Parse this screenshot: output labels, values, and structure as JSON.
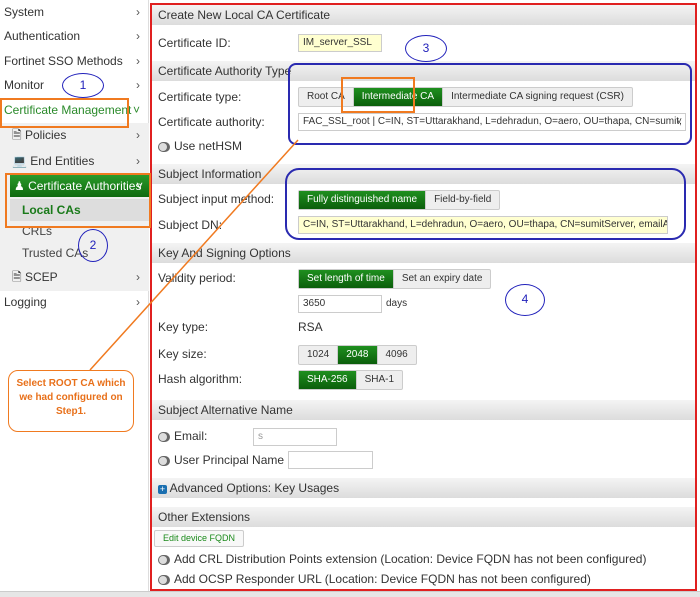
{
  "sidebar": {
    "items": [
      {
        "label": "System"
      },
      {
        "label": "Authentication"
      },
      {
        "label": "Fortinet SSO Methods"
      },
      {
        "label": "Monitor"
      },
      {
        "label": "Certificate Management"
      },
      {
        "label": "Policies"
      },
      {
        "label": "End Entities"
      },
      {
        "label": "Certificate Authorities"
      },
      {
        "label": "Local CAs"
      },
      {
        "label": "CRLs"
      },
      {
        "label": "Trusted CAs"
      },
      {
        "label": "SCEP"
      },
      {
        "label": "Logging"
      }
    ]
  },
  "form": {
    "title": "Create New Local CA Certificate",
    "cert_id_label": "Certificate ID:",
    "cert_id_value": "IM_server_SSL",
    "ca_type_header": "Certificate Authority Type",
    "cert_type_label": "Certificate type:",
    "cert_types": [
      "Root CA",
      "Intermediate CA",
      "Intermediate CA signing request (CSR)"
    ],
    "cert_authority_label": "Certificate authority:",
    "cert_authority_value": "FAC_SSL_root | C=IN, ST=Uttarakhand, L=dehradun, O=aero, OU=thapa, CN=sumit, emailAddress=sthapa@gmail.com",
    "nethsm_label": "Use netHSM",
    "subject_header": "Subject Information",
    "input_method_label": "Subject input method:",
    "input_methods": [
      "Fully distinguished name",
      "Field-by-field"
    ],
    "subject_dn_label": "Subject DN:",
    "subject_dn_value": "C=IN, ST=Uttarakhand, L=dehradun, O=aero, OU=thapa, CN=sumitServer, emailAddress=sthapa@gmail.com",
    "key_header": "Key And Signing Options",
    "validity_label": "Validity period:",
    "validity_options": [
      "Set length of time",
      "Set an expiry date"
    ],
    "validity_value": "3650",
    "validity_unit": "days",
    "key_type_label": "Key type:",
    "key_type_value": "RSA",
    "key_size_label": "Key size:",
    "key_sizes": [
      "1024",
      "2048",
      "4096"
    ],
    "hash_label": "Hash algorithm:",
    "hashes": [
      "SHA-256",
      "SHA-1"
    ],
    "san_header": "Subject Alternative Name",
    "email_label": "Email:",
    "email_value": "s",
    "upn_label": "User Principal Name (UPN):",
    "advanced_header": "Advanced Options: Key Usages",
    "ext_header": "Other Extensions",
    "edit_fqdn": "Edit device FQDN",
    "crl_label": "Add CRL Distribution Points extension (Location: Device FQDN has not been configured)",
    "ocsp_label": "Add OCSP Responder URL (Location: Device FQDN has not been configured)"
  },
  "annotations": {
    "n1": "1",
    "n2": "2",
    "n3": "3",
    "n4": "4",
    "callout": "Select ROOT CA which we had configured on Step1."
  },
  "colors": {
    "accent": "#128012",
    "annotation_blue": "#2a2ab0",
    "annotation_orange": "#f07a20",
    "frame_red": "#e02020"
  }
}
